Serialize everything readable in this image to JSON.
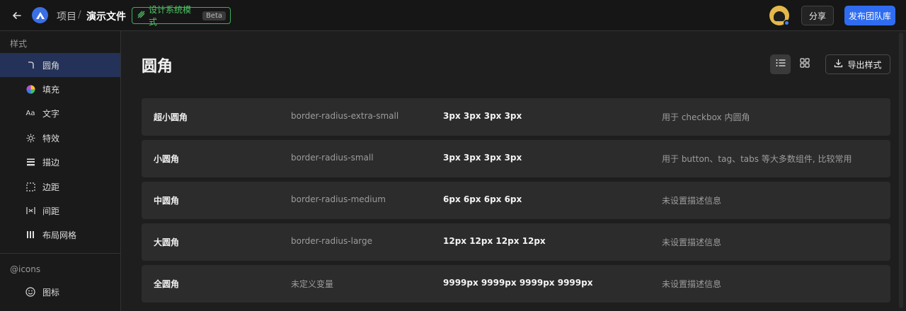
{
  "topbar": {
    "breadcrumb_project": "项目",
    "breadcrumb_sep": "/",
    "breadcrumb_file": "演示文件",
    "design_mode_label": "设计系统模式",
    "beta_label": "Beta",
    "share_label": "分享",
    "publish_label": "发布团队库"
  },
  "sidebar": {
    "section_styles": "样式",
    "items": [
      {
        "label": "圆角",
        "icon": "corner-radius-icon",
        "active": true
      },
      {
        "label": "填充",
        "icon": "color-wheel-icon"
      },
      {
        "label": "文字",
        "icon": "text-icon"
      },
      {
        "label": "特效",
        "icon": "effects-sun-icon"
      },
      {
        "label": "描边",
        "icon": "stroke-lines-icon"
      },
      {
        "label": "边距",
        "icon": "padding-icon"
      },
      {
        "label": "间距",
        "icon": "spacing-icon"
      },
      {
        "label": "布局网格",
        "icon": "layout-grid-icon"
      }
    ],
    "section_icons": "@icons",
    "icons_item": {
      "label": "图标",
      "icon": "smiley-icon"
    }
  },
  "main": {
    "title": "圆角",
    "text_icon_glyph": "Aa",
    "export_label": "导出样式",
    "rows": [
      {
        "name": "超小圆角",
        "variable": "border-radius-extra-small",
        "value": "3px 3px 3px 3px",
        "description": "用于 checkbox 内圆角"
      },
      {
        "name": "小圆角",
        "variable": "border-radius-small",
        "value": "3px 3px 3px 3px",
        "description": "用于 button、tag、tabs 等大多数组件, 比较常用"
      },
      {
        "name": "中圆角",
        "variable": "border-radius-medium",
        "value": "6px 6px 6px 6px",
        "description": "未设置描述信息"
      },
      {
        "name": "大圆角",
        "variable": "border-radius-large",
        "value": "12px 12px 12px 12px",
        "description": "未设置描述信息"
      },
      {
        "name": "全圆角",
        "variable": "未定义变量",
        "value": "9999px 9999px 9999px 9999px",
        "description": "未设置描述信息"
      }
    ]
  },
  "colors": {
    "accent_blue": "#2f6cf0",
    "active_bg": "#243259",
    "design_mode_green": "#4cc463"
  }
}
